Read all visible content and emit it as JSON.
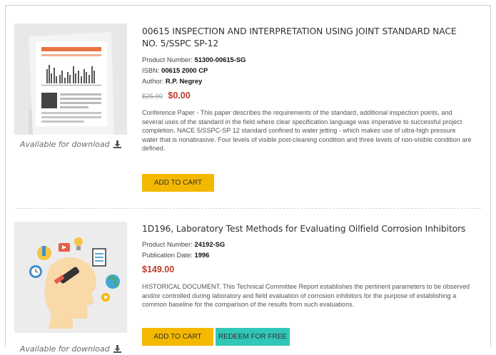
{
  "products": [
    {
      "title": "00615 INSPECTION AND INTERPRETATION USING JOINT STANDARD NACE NO. 5/SSPC SP-12",
      "meta": [
        {
          "label": "Product Number:",
          "value": "51300-00615-SG"
        },
        {
          "label": "ISBN:",
          "value": "00615 2000 CP"
        },
        {
          "label": "Author:",
          "value": "R.P. Negrey"
        }
      ],
      "old_price": "$25.00",
      "price": "$0.00",
      "description": "Conference Paper - This paper describes the requirements of the standard, additional inspection points, and several uses of the standard in the field where clear specification language was imperative to successful project completion. NACE 5/SSPC-SP 12 standard confined to water jetting - which makes use of ultra-high pressure water that is nonabrasive.  Four levels of visible post-cleaning condition and three levels of non-visible condition are defined.",
      "availability": "Available for download",
      "add_to_cart": "ADD TO CART"
    },
    {
      "title": "1D196, Laboratory Test Methods for Evaluating Oilfield Corrosion Inhibitors",
      "meta": [
        {
          "label": "Product Number:",
          "value": "24192-SG"
        },
        {
          "label": "Publication Date:",
          "value": "1996"
        }
      ],
      "price": "$149.00",
      "description": "HISTORICAL DOCUMENT. This Technical Committee Report establishes the pertinent parameters to be observed and/or controlled during laboratory and field evaluation of corrosion inhibitors for the purpose of establishing a common baseline for the comparison of the results from such evaluations.",
      "availability": "Available for download",
      "add_to_cart": "ADD TO CART",
      "redeem": "REDEEM FOR FREE"
    }
  ],
  "colors": {
    "accent_yellow": "#f5b800",
    "accent_teal": "#31c7b8",
    "price_red": "#c0392b"
  },
  "icons": {
    "download": "download-icon",
    "thumb1": "document-chart-icon",
    "thumb2": "research-head-icon"
  }
}
